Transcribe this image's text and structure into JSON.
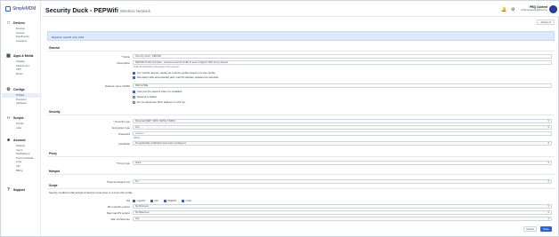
{
  "brand": {
    "name": "SimpleMDM"
  },
  "sidebar": {
    "groups": [
      {
        "label": "Devices",
        "icon": "monitor-icon",
        "items": [
          "Devices",
          "Groups",
          "Enrollments",
          "Locations"
        ]
      },
      {
        "label": "Apps & Media",
        "icon": "grid-icon",
        "items": [
          "Catalog",
          "Assignment",
          "VPP",
          "Munki"
        ]
      },
      {
        "label": "Configs",
        "icon": "gear-icon",
        "items": [
          "Profiles",
          "Provision",
          "Attributes"
        ]
      },
      {
        "label": "Scripts",
        "icon": "code-icon",
        "items": [
          "Scripts",
          "Jobs"
        ]
      },
      {
        "label": "Account",
        "icon": "user-icon",
        "items": [
          "Settings",
          "Users",
          "Notifications",
          "Push Certificate",
          "Logs",
          "API",
          "Billing"
        ]
      },
      {
        "label": "Support",
        "icon": "help-icon",
        "items": []
      }
    ]
  },
  "header": {
    "title": "Security Duck - PEPWifi",
    "subtitle": "Wireless Network",
    "user_name": "PBQ Content",
    "user_email": "andrew.pepper@pbq.com"
  },
  "actions_label": "Actions ▾",
  "info_bar": "Required: macOS, iOS, tvOS",
  "sections": {
    "general": "General",
    "security": "Security",
    "proxy": "Proxy",
    "hotspot": "Hotspot",
    "scope": "Scope"
  },
  "general": {
    "name_label": "* Name",
    "name_value": "Security Duck - PEPWifi",
    "description_label": "Description",
    "description_value": "PEPWifi Profile Template - wireless network profile to auto configure PEP home devices",
    "description_help": "Optional description presented to the end user.",
    "opt1": "For macOS devices, deploy as a device profile instead of a user profile.",
    "opt2": "Reinstall profile automatically after macOS software updates are detected.",
    "ssid_label": "Network name (SSID)",
    "ssid_value": "PEP-HOME",
    "auto_join": "Auto join the network when it is available",
    "hidden": "Network is hidden",
    "private_mac": "Do not randomize MAC address on iOS 14+"
  },
  "security": {
    "security_type_label": "* Security type",
    "security_type_value": "Personal WEP / WPA / WPA2 / WPA3",
    "encryption_label": "Encryption type",
    "encryption_value": "Any",
    "password_label": "Password",
    "password_value": "••••••••••",
    "password_reveal": "Show",
    "certificate_label": "Certificate",
    "certificate_value": "No applicable certificates have been configured"
  },
  "proxy": {
    "label": "* Proxy type",
    "value": "None"
  },
  "hotspot": {
    "label": "Treat as Hotspot 2.0",
    "value": "No"
  },
  "scope": {
    "description": "Specify conditions that assigned devices must meet to receive this profile.",
    "os_label": "OS",
    "os_options": [
      "macOS",
      "iOS",
      "iPadOS",
      "tvOS"
    ],
    "min_label": "Min macOS version",
    "min_value": "No Minimum",
    "max_label": "Max macOS version",
    "max_value": "No Maximum",
    "arch_label": "Mac architecture",
    "arch_value": "Any"
  },
  "buttons": {
    "cancel": "Cancel",
    "save": "Save"
  }
}
